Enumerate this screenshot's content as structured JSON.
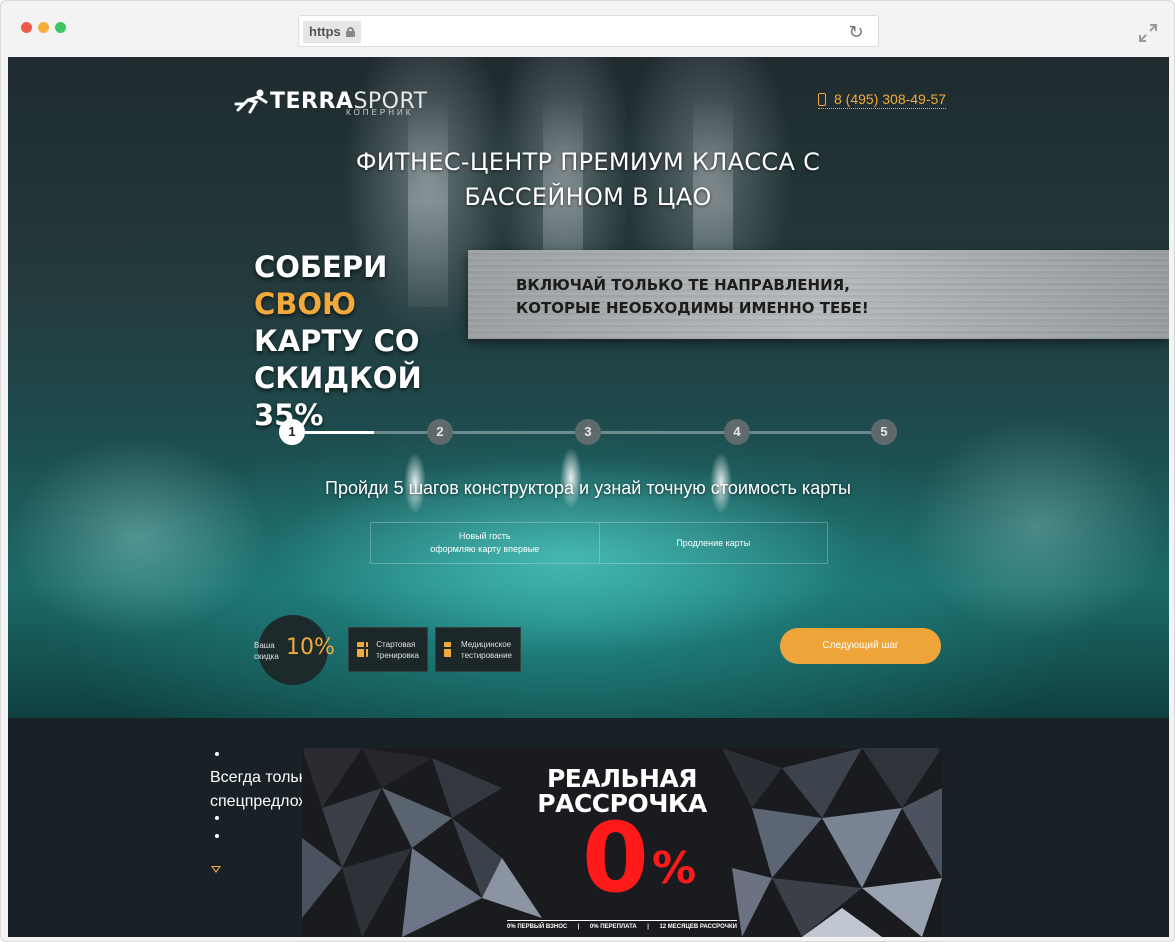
{
  "browser": {
    "url_scheme": "https",
    "reload_icon": "reload-icon",
    "expand_icon": "expand-icon"
  },
  "header": {
    "logo_main": "TERRA",
    "logo_accent": "SPORT",
    "logo_sub": "КОПЕРНИК",
    "phone": "8 (495) 308-49-57"
  },
  "hero": {
    "headline": "ФИТНЕС-ЦЕНТР ПРЕМИУМ КЛАССА С БАССЕЙНОМ В ЦАО",
    "promo_line1_a": "СОБЕРИ ",
    "promo_line1_accent": "СВОЮ",
    "promo_line2": "КАРТУ СО",
    "promo_line3": "СКИДКОЙ 35%",
    "banner_text": "ВКЛЮЧАЙ ТОЛЬКО ТЕ НАПРАВЛЕНИЯ, КОТОРЫЕ НЕОБХОДИМЫ ИМЕННО ТЕБЕ!",
    "steps": [
      "1",
      "2",
      "3",
      "4",
      "5"
    ],
    "active_step": 1,
    "progress_fraction": 0.14,
    "subtitle": "Пройди 5 шагов конструктора и узнай точную стоимость карты",
    "options": [
      {
        "line1": "Новый гость",
        "line2": "оформляю карту впервые"
      },
      {
        "line1": "Продление карты",
        "line2": ""
      }
    ],
    "discount_label": "Ваша скидка",
    "discount_value": "10%",
    "gifts": [
      {
        "line1": "Стартовая",
        "line2": "тренировка"
      },
      {
        "line1": "Медицинское",
        "line2": "тестирование"
      }
    ],
    "next_button": "Следующий шаг"
  },
  "offers": {
    "text": "Всегда только самые интересные спецпредложения",
    "card_title_line1": "РЕАЛЬНАЯ",
    "card_title_line2": "РАССРОЧКА",
    "card_big": "0",
    "card_pct": "%",
    "terms": [
      "0% ПЕРВЫЙ ВЗНОС",
      "|",
      "0% ПЕРЕПЛАТА",
      "|",
      "12 МЕСЯЦЕВ РАССРОЧКИ"
    ]
  },
  "colors": {
    "accent": "#f2a93b",
    "button": "#eda53a",
    "dark_bg": "#182226",
    "card_red": "#ff1a1a"
  }
}
